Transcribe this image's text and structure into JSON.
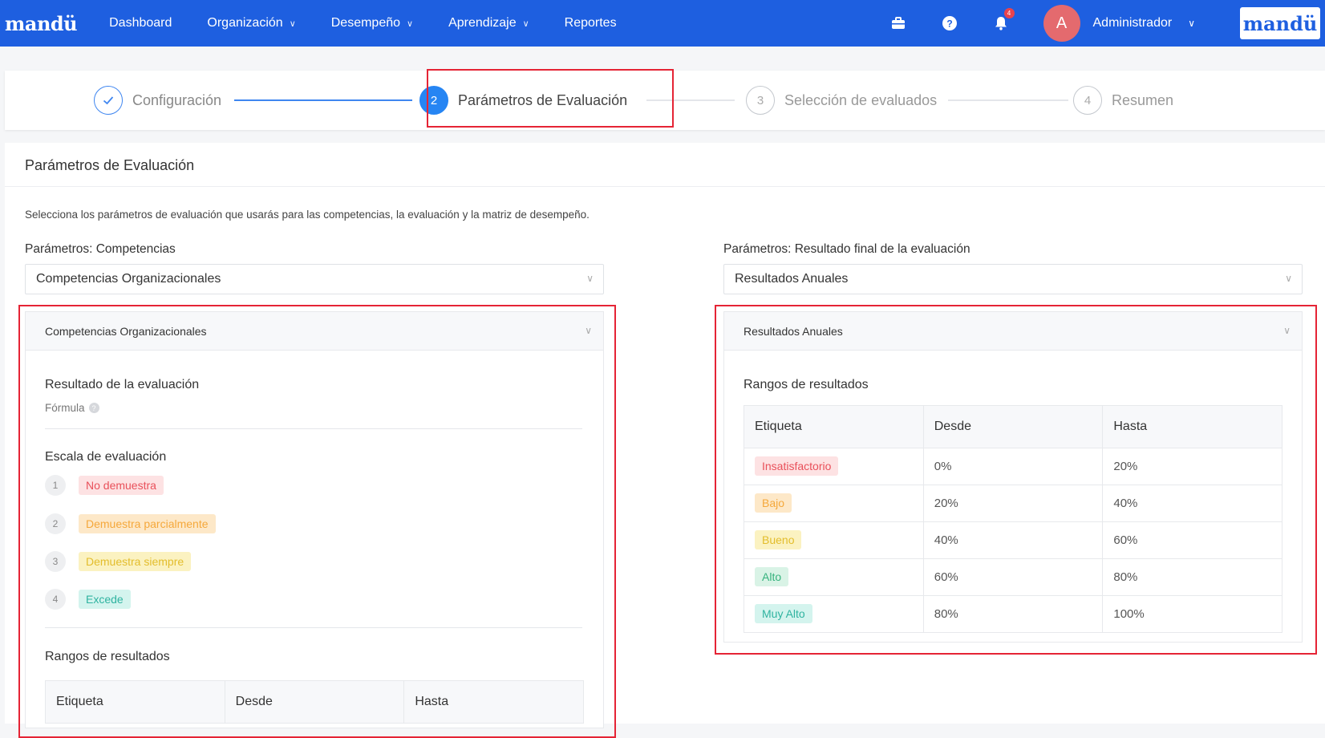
{
  "nav": {
    "brand": "mandü",
    "items": [
      {
        "label": "Dashboard",
        "has_dropdown": false
      },
      {
        "label": "Organización",
        "has_dropdown": true
      },
      {
        "label": "Desempeño",
        "has_dropdown": true
      },
      {
        "label": "Aprendizaje",
        "has_dropdown": true
      },
      {
        "label": "Reportes",
        "has_dropdown": false
      }
    ],
    "notification_count": "4",
    "avatar_initial": "A",
    "user_name": "Administrador",
    "brand_logo": "mandü",
    "icons": [
      "briefcase-icon",
      "help-icon",
      "bell-icon"
    ]
  },
  "stepper": {
    "steps": [
      {
        "number": "✓",
        "label": "Configuración",
        "state": "done"
      },
      {
        "number": "2",
        "label": "Parámetros de Evaluación",
        "state": "active"
      },
      {
        "number": "3",
        "label": "Selección de evaluados",
        "state": "pending"
      },
      {
        "number": "4",
        "label": "Resumen",
        "state": "pending"
      }
    ]
  },
  "main": {
    "title": "Parámetros de Evaluación",
    "description": "Selecciona los parámetros de evaluación que usarás para las competencias, la evaluación y la matriz de desempeño.",
    "competencias": {
      "label": "Parámetros: Competencias",
      "selected": "Competencias Organizacionales",
      "panel_title": "Competencias Organizacionales",
      "resultado_title": "Resultado de la evaluación",
      "formula_label": "Fórmula",
      "escala_title": "Escala de evaluación",
      "escala": [
        {
          "num": "1",
          "label": "No demuestra",
          "color": "#e9505a"
        },
        {
          "num": "2",
          "label": "Demuestra parcialmente",
          "color": "#f5a83b"
        },
        {
          "num": "3",
          "label": "Demuestra siempre",
          "color": "#e3bd2c"
        },
        {
          "num": "4",
          "label": "Excede",
          "color": "#2fb3a0"
        }
      ],
      "rangos_title": "Rangos de resultados",
      "columns": [
        "Etiqueta",
        "Desde",
        "Hasta"
      ]
    },
    "resultado_final": {
      "label": "Parámetros: Resultado final de la evaluación",
      "selected": "Resultados Anuales",
      "panel_title": "Resultados Anuales",
      "rangos_title": "Rangos de resultados",
      "columns": [
        "Etiqueta",
        "Desde",
        "Hasta"
      ],
      "rows": [
        {
          "label": "Insatisfactorio",
          "desde": "0%",
          "hasta": "20%",
          "color": "#e9505a"
        },
        {
          "label": "Bajo",
          "desde": "20%",
          "hasta": "40%",
          "color": "#f5a83b"
        },
        {
          "label": "Bueno",
          "desde": "40%",
          "hasta": "60%",
          "color": "#e3bd2c"
        },
        {
          "label": "Alto",
          "desde": "60%",
          "hasta": "80%",
          "color": "#36b37e"
        },
        {
          "label": "Muy Alto",
          "desde": "80%",
          "hasta": "100%",
          "color": "#2fb3a0"
        }
      ]
    }
  }
}
